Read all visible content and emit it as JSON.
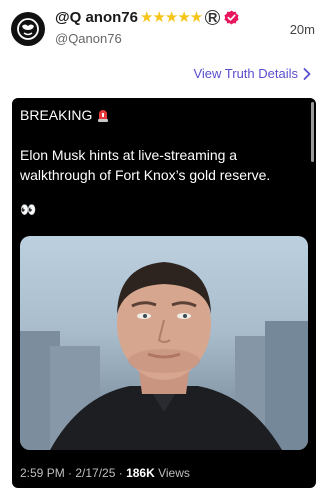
{
  "post": {
    "display_name": "@Q anon76",
    "handle": "@Qanon76",
    "time_ago": "20m",
    "star_count": 5,
    "registered_mark": "R",
    "view_details_label": "View Truth Details",
    "headline": "BREAKING",
    "text": "Elon Musk hints at live-streaming a walkthrough of Fort Knox’s gold reserve.",
    "emoji": "👀",
    "footer": {
      "timestamp": "2:59 PM · 2/17/25 · ",
      "views_count": "186K",
      "views_label": " Views"
    }
  },
  "icons": {
    "avatar": "mask-face-icon",
    "verified": "verified-badge-icon",
    "siren": "siren-icon",
    "chevron": "chevron-right-icon"
  },
  "colors": {
    "link": "#5a4fcf",
    "star": "#f5c518",
    "verified": "#e8175d",
    "card_bg": "#000000"
  }
}
